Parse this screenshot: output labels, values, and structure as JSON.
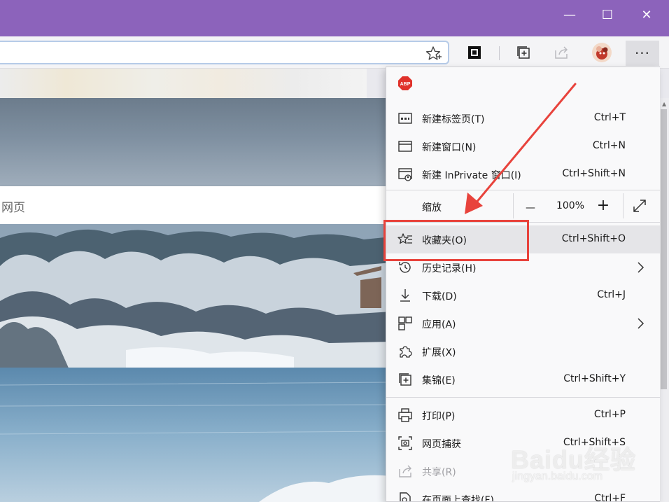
{
  "window": {
    "minimize_glyph": "—",
    "maximize_glyph": "☐",
    "close_glyph": "✕",
    "titlebar_color": "#8c63bb"
  },
  "toolbar": {
    "more_glyph": "···"
  },
  "page": {
    "search_hint": "网页"
  },
  "menu": {
    "items": [
      {
        "label": "新建标签页(T)",
        "shortcut": "Ctrl+T",
        "icon": "new-tab-icon"
      },
      {
        "label": "新建窗口(N)",
        "shortcut": "Ctrl+N",
        "icon": "new-window-icon"
      },
      {
        "label": "新建 InPrivate 窗口(I)",
        "shortcut": "Ctrl+Shift+N",
        "icon": "inprivate-window-icon"
      },
      {
        "label": "收藏夹(O)",
        "shortcut": "Ctrl+Shift+O",
        "icon": "favorites-icon",
        "highlighted": true
      },
      {
        "label": "历史记录(H)",
        "shortcut": "",
        "icon": "history-icon",
        "submenu": true
      },
      {
        "label": "下载(D)",
        "shortcut": "Ctrl+J",
        "icon": "download-icon"
      },
      {
        "label": "应用(A)",
        "shortcut": "",
        "icon": "apps-icon",
        "submenu": true
      },
      {
        "label": "扩展(X)",
        "shortcut": "",
        "icon": "extensions-icon"
      },
      {
        "label": "集锦(E)",
        "shortcut": "Ctrl+Shift+Y",
        "icon": "collections-icon"
      },
      {
        "label": "打印(P)",
        "shortcut": "Ctrl+P",
        "icon": "print-icon"
      },
      {
        "label": "网页捕获",
        "shortcut": "Ctrl+Shift+S",
        "icon": "web-capture-icon"
      },
      {
        "label": "共享(R)",
        "shortcut": "",
        "icon": "share-icon",
        "disabled": true
      },
      {
        "label": "在页面上查找(F)",
        "shortcut": "Ctrl+F",
        "icon": "find-icon"
      }
    ],
    "zoom": {
      "label": "缩放",
      "minus": "—",
      "value": "100%",
      "plus": "+"
    }
  },
  "watermark": {
    "main": "Baidu经验",
    "sub": "jingyan.baidu.com"
  },
  "colors": {
    "accent_annotation": "#e8433c",
    "abp_red": "#e0322b"
  }
}
